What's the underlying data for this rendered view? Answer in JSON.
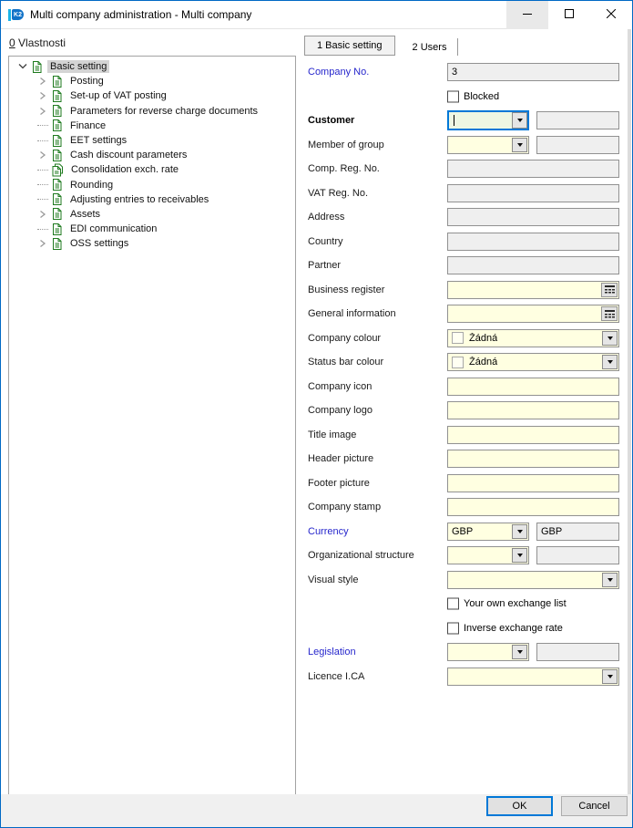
{
  "window": {
    "title": "Multi company administration - Multi company",
    "app_icon": "k2-logo-icon"
  },
  "titlebar_buttons": [
    {
      "name": "minimize-button",
      "icon": "minimize-icon",
      "hovered": true
    },
    {
      "name": "maximize-button",
      "icon": "maximize-icon",
      "hovered": false
    },
    {
      "name": "close-button",
      "icon": "close-icon",
      "hovered": false
    }
  ],
  "left_panel": {
    "header_accel": "0",
    "header_text": " Vlastnosti",
    "tree": [
      {
        "label": "Basic setting",
        "level": 0,
        "expand": "expanded",
        "selected": true,
        "icon": "document-icon"
      },
      {
        "label": "Posting",
        "level": 1,
        "expand": "collapsed",
        "icon": "document-icon"
      },
      {
        "label": "Set-up of VAT posting",
        "level": 1,
        "expand": "collapsed",
        "icon": "document-icon"
      },
      {
        "label": "Parameters for reverse charge documents",
        "level": 1,
        "expand": "collapsed",
        "icon": "document-icon"
      },
      {
        "label": "Finance",
        "level": 1,
        "expand": "none",
        "icon": "document-icon"
      },
      {
        "label": "EET settings",
        "level": 1,
        "expand": "none",
        "icon": "document-icon"
      },
      {
        "label": "Cash discount parameters",
        "level": 1,
        "expand": "collapsed",
        "icon": "document-icon"
      },
      {
        "label": "Consolidation exch. rate",
        "level": 1,
        "expand": "none",
        "icon": "documents-icon"
      },
      {
        "label": "Rounding",
        "level": 1,
        "expand": "none",
        "icon": "document-icon"
      },
      {
        "label": "Adjusting entries to receivables",
        "level": 1,
        "expand": "none",
        "icon": "document-icon"
      },
      {
        "label": "Assets",
        "level": 1,
        "expand": "collapsed",
        "icon": "document-icon"
      },
      {
        "label": "EDI communication",
        "level": 1,
        "expand": "none",
        "icon": "document-icon"
      },
      {
        "label": "OSS settings",
        "level": 1,
        "expand": "collapsed",
        "icon": "document-icon"
      }
    ]
  },
  "tabs": [
    {
      "label": "1 Basic setting",
      "active": true
    },
    {
      "label": "2 Users",
      "active": false
    }
  ],
  "form": {
    "rows": [
      {
        "type": "field",
        "label": "Company No.",
        "label_style": "link",
        "value": "3",
        "field": "disabled"
      },
      {
        "type": "checkbox",
        "label": "Blocked",
        "checked": false
      },
      {
        "type": "combo-pair",
        "label": "Customer",
        "label_style": "bold",
        "combo_value": "",
        "pair_value": "",
        "focused": true
      },
      {
        "type": "combo-pair",
        "label": "Member of group",
        "combo_value": "",
        "pair_value": ""
      },
      {
        "type": "field",
        "label": "Comp. Reg. No.",
        "value": "",
        "field": "disabled"
      },
      {
        "type": "field",
        "label": "VAT Reg. No.",
        "value": "",
        "field": "disabled"
      },
      {
        "type": "field",
        "label": "Address",
        "value": "",
        "field": "disabled"
      },
      {
        "type": "field",
        "label": "Country",
        "value": "",
        "field": "disabled"
      },
      {
        "type": "field",
        "label": "Partner",
        "value": "",
        "field": "disabled"
      },
      {
        "type": "field",
        "label": "Business register",
        "value": "",
        "field": "editable",
        "trailing_icon": "table-lookup-icon"
      },
      {
        "type": "field",
        "label": "General information",
        "value": "",
        "field": "editable",
        "trailing_icon": "table-lookup-icon"
      },
      {
        "type": "combo-color",
        "label": "Company colour",
        "value": "Žádná"
      },
      {
        "type": "combo-color",
        "label": "Status bar colour",
        "value": "Žádná"
      },
      {
        "type": "field",
        "label": "Company icon",
        "value": "",
        "field": "editable"
      },
      {
        "type": "field",
        "label": "Company logo",
        "value": "",
        "field": "editable"
      },
      {
        "type": "field",
        "label": "Title image",
        "value": "",
        "field": "editable"
      },
      {
        "type": "field",
        "label": "Header picture",
        "value": "",
        "field": "editable"
      },
      {
        "type": "field",
        "label": "Footer picture",
        "value": "",
        "field": "editable"
      },
      {
        "type": "field",
        "label": "Company stamp",
        "value": "",
        "field": "editable"
      },
      {
        "type": "combo-pair",
        "label": "Currency",
        "label_style": "link",
        "combo_value": "GBP",
        "pair_value": "GBP"
      },
      {
        "type": "combo-pair",
        "label": "Organizational structure",
        "combo_value": "",
        "pair_value": ""
      },
      {
        "type": "combo-full",
        "label": "Visual style",
        "value": ""
      },
      {
        "type": "checkbox",
        "label": "Your own exchange list",
        "checked": false
      },
      {
        "type": "checkbox",
        "label": "Inverse exchange rate",
        "checked": false
      },
      {
        "type": "combo-pair",
        "label": "Legislation",
        "label_style": "link",
        "combo_value": "",
        "pair_value": ""
      },
      {
        "type": "combo-full",
        "label": "Licence I.CA",
        "value": ""
      }
    ]
  },
  "footer": {
    "ok_label": "OK",
    "cancel_label": "Cancel"
  },
  "colors": {
    "accent": "#0078d7",
    "editable_field_bg": "#ffffe1",
    "focused_field_bg": "#eef7e3",
    "disabled_field_bg": "#efefef",
    "link_label": "#2626cc",
    "selection_bg": "#d4d4d4",
    "window_border": "#0069c5"
  }
}
